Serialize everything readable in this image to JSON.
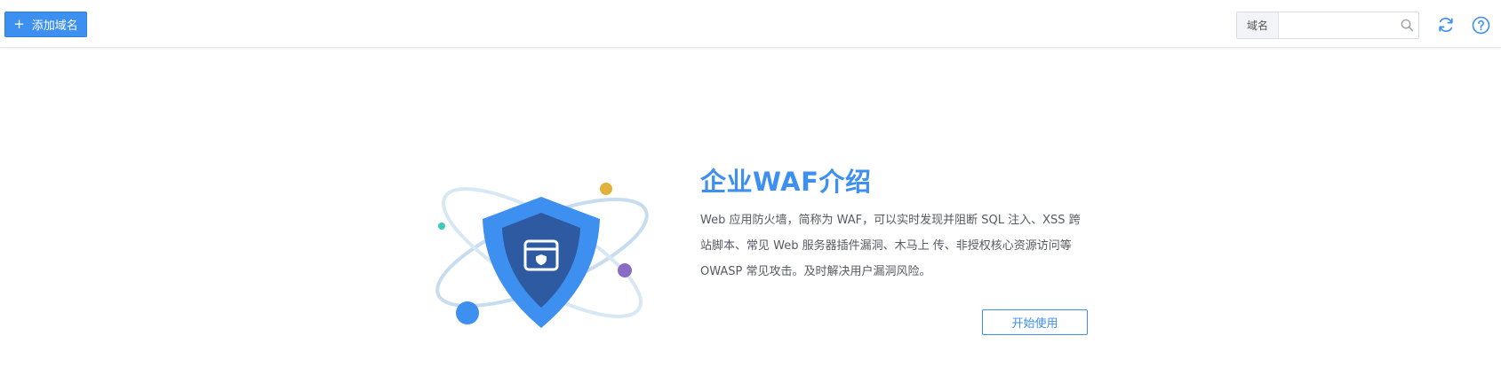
{
  "toolbar": {
    "add_domain_label": "添加域名",
    "search": {
      "label": "域名",
      "value": "",
      "placeholder": ""
    },
    "icons": {
      "add": "plus-icon",
      "search": "search-icon",
      "refresh": "refresh-icon",
      "help": "help-icon"
    }
  },
  "intro": {
    "title": "企业WAF介绍",
    "description_lines": [
      "Web 应用防火墙，简称为 WAF，可以实时发现并阻断 SQL 注入、XSS 跨",
      "站脚本、常见 Web 服务器插件漏洞、木马上 传、非授权核心资源访问等",
      "OWASP 常见攻击。及时解决用户漏洞风险。"
    ],
    "start_button_label": "开始使用",
    "illustration": "waf-shield-illustration"
  },
  "colors": {
    "accent": "#3d8ff0",
    "text": "#555a63",
    "shield_dark": "#2d5aa0",
    "orbit": "#c9dff0"
  }
}
